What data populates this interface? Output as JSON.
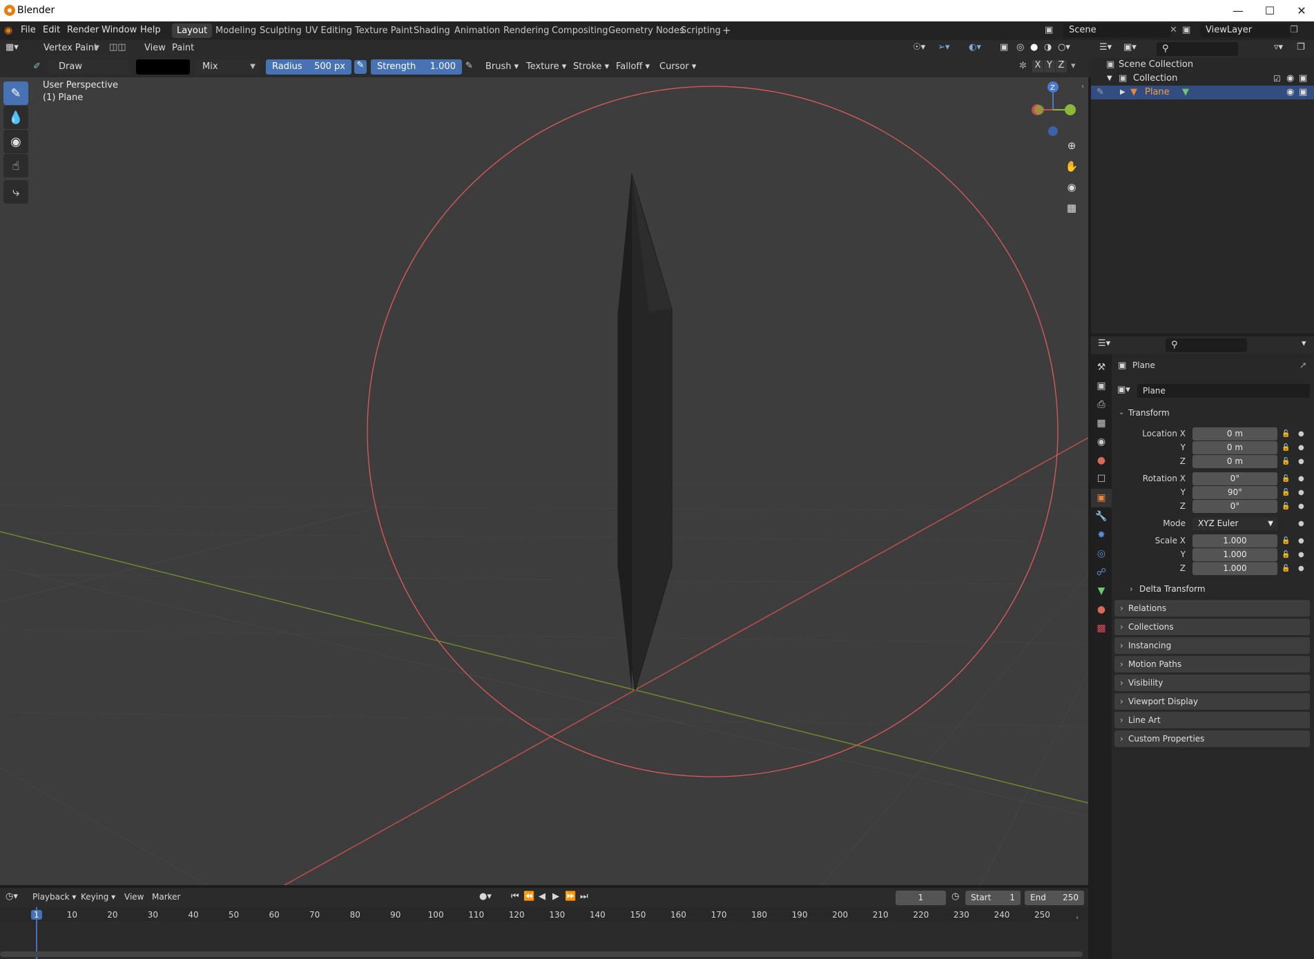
{
  "window": {
    "title": "Blender",
    "minimize_icon": "minimize-icon",
    "maximize_icon": "maximize-icon",
    "close_icon": "close-icon"
  },
  "menus": [
    "File",
    "Edit",
    "Render",
    "Window",
    "Help"
  ],
  "workspaces": [
    "Layout",
    "Modeling",
    "Sculpting",
    "UV Editing",
    "Texture Paint",
    "Shading",
    "Animation",
    "Rendering",
    "Compositing",
    "Geometry Nodes",
    "Scripting"
  ],
  "active_workspace": "Layout",
  "add_workspace": "+",
  "scene": "Scene",
  "view_layer": "ViewLayer",
  "viewport_header": {
    "mode": "Vertex Paint",
    "view": "View",
    "paint": "Paint"
  },
  "tool_header": {
    "brush_name": "Draw",
    "blend": "Mix",
    "radius_label": "Radius",
    "radius_value": "500 px",
    "strength_label": "Strength",
    "strength_value": "1.000",
    "menus": [
      "Brush",
      "Texture",
      "Stroke",
      "Falloff",
      "Cursor"
    ],
    "axes": [
      "X",
      "Y",
      "Z"
    ],
    "color_swatch": "#000000"
  },
  "viewport": {
    "perspective": "User Perspective",
    "object": "(1) Plane",
    "gizmo_z": "Z",
    "colors": {
      "background": "#3d3d3d",
      "x_axis": "#c0504d",
      "y_axis": "#6d8a2c",
      "brush_circle": "#e05a5a"
    }
  },
  "tools": [
    "draw-brush-icon",
    "blur-icon",
    "average-icon",
    "smear-icon",
    "annotate-icon"
  ],
  "outliner": {
    "root": "Scene Collection",
    "collection": "Collection",
    "object": "Plane"
  },
  "properties": {
    "object_name": "Plane",
    "data_name": "Plane",
    "transform": "Transform",
    "location_label": "Location X",
    "location": [
      "0 m",
      "0 m",
      "0 m"
    ],
    "rotation_label": "Rotation X",
    "rotation": [
      "0°",
      "90°",
      "0°"
    ],
    "mode_label": "Mode",
    "mode": "XYZ Euler",
    "scale_label": "Scale X",
    "scale": [
      "1.000",
      "1.000",
      "1.000"
    ],
    "y_label": "Y",
    "z_label": "Z",
    "delta": "Delta Transform",
    "panels": [
      "Relations",
      "Collections",
      "Instancing",
      "Motion Paths",
      "Visibility",
      "Viewport Display",
      "Line Art",
      "Custom Properties"
    ]
  },
  "timeline": {
    "menus": [
      "Playback",
      "Keying",
      "View",
      "Marker"
    ],
    "current_frame": "1",
    "start_label": "Start",
    "start": "1",
    "end_label": "End",
    "end": "250",
    "ticks": [
      "1",
      "10",
      "20",
      "30",
      "40",
      "50",
      "60",
      "70",
      "80",
      "90",
      "100",
      "110",
      "120",
      "130",
      "140",
      "150",
      "160",
      "170",
      "180",
      "190",
      "200",
      "210",
      "220",
      "230",
      "240",
      "250"
    ]
  }
}
